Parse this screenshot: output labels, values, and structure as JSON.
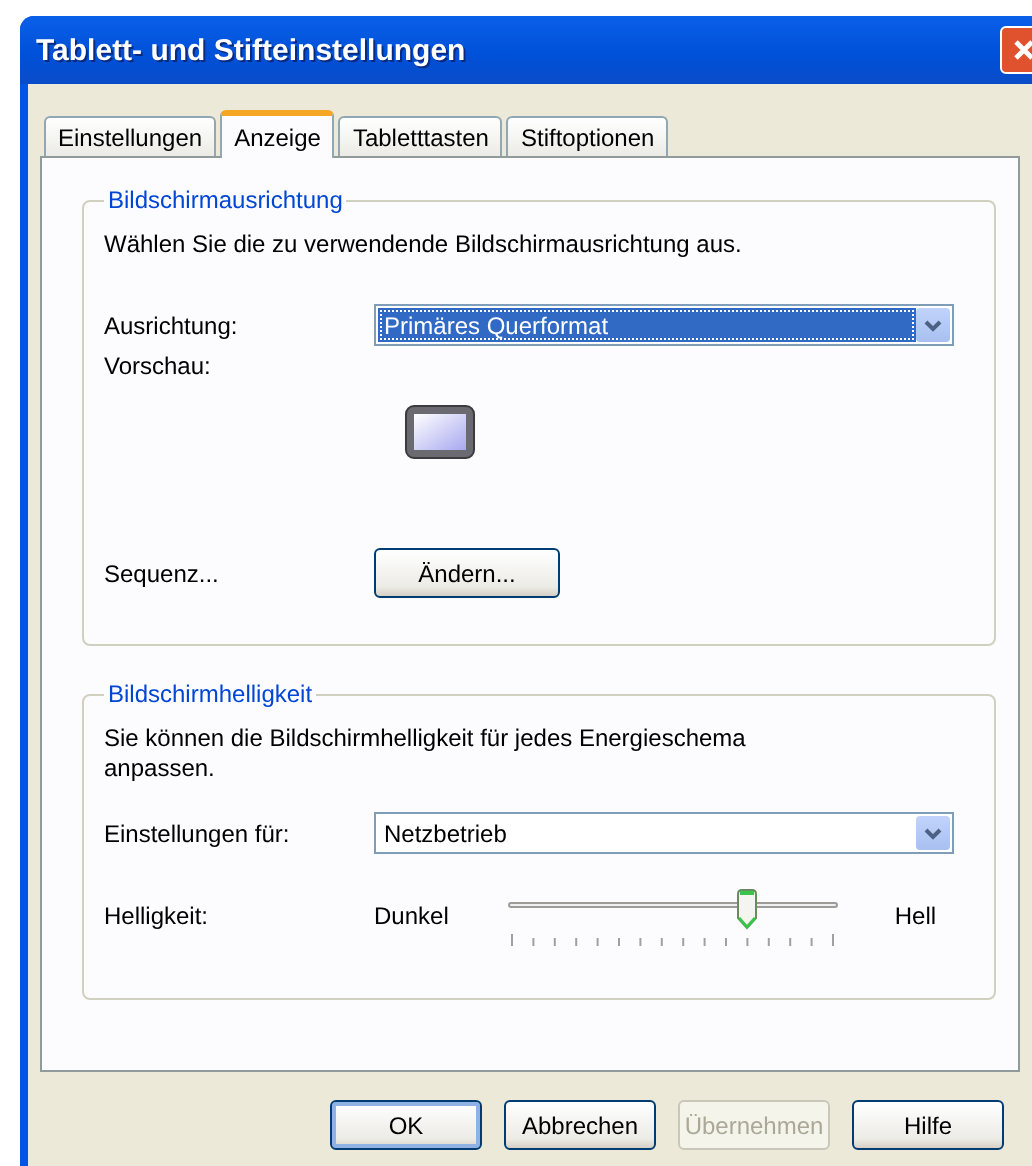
{
  "window": {
    "title": "Tablett- und Stifteinstellungen"
  },
  "tabs": [
    {
      "label": "Einstellungen",
      "selected": false
    },
    {
      "label": "Anzeige",
      "selected": true
    },
    {
      "label": "Tabletttasten",
      "selected": false
    },
    {
      "label": "Stiftoptionen",
      "selected": false
    }
  ],
  "orientation_group": {
    "title": "Bildschirmausrichtung",
    "description": "Wählen Sie die zu verwendende Bildschirmausrichtung aus.",
    "orientation": {
      "label": "Ausrichtung:",
      "value": "Primäres Querformat",
      "focused": true
    },
    "preview_label": "Vorschau:",
    "sequence_label": "Sequenz...",
    "change_button": "Ändern..."
  },
  "brightness_group": {
    "title": "Bildschirmhelligkeit",
    "description": "Sie können die Bildschirmhelligkeit für jedes Energieschema anpassen.",
    "settings_for": {
      "label": "Einstellungen für:",
      "value": "Netzbetrieb",
      "focused": false
    },
    "brightness": {
      "label": "Helligkeit:",
      "min_label": "Dunkel",
      "max_label": "Hell",
      "level": 0.72
    }
  },
  "buttons": [
    {
      "label": "OK",
      "disabled": false,
      "default": true
    },
    {
      "label": "Abbrechen",
      "disabled": false,
      "default": false
    },
    {
      "label": "Übernehmen",
      "disabled": true,
      "default": false
    },
    {
      "label": "Hilfe",
      "disabled": false,
      "default": false
    }
  ]
}
